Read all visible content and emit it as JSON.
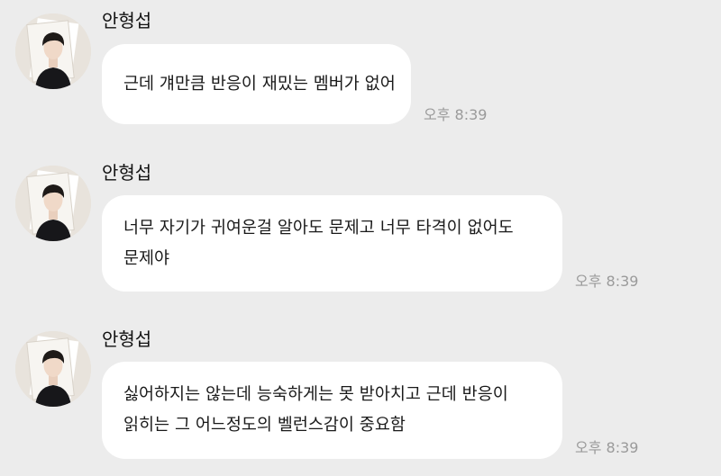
{
  "messages": [
    {
      "sender": "안형섭",
      "lines": [
        "근데 걔만큼 반응이 재밌는 멤버가 없어"
      ],
      "time": "오후 8:39"
    },
    {
      "sender": "안형섭",
      "lines": [
        "너무 자기가 귀여운걸 알아도 문제고 너무 타격이 없어도",
        "문제야"
      ],
      "time": "오후 8:39"
    },
    {
      "sender": "안형섭",
      "lines": [
        "싫어하지는 않는데 능숙하게는 못 받아치고 근데 반응이",
        "읽히는 그 어느정도의 벨런스감이 중요함"
      ],
      "time": "오후 8:39"
    }
  ],
  "avatar_icon": "profile-photo",
  "colors": {
    "background": "#ececec",
    "bubble": "#ffffff",
    "time_text": "#9a9a9a"
  }
}
